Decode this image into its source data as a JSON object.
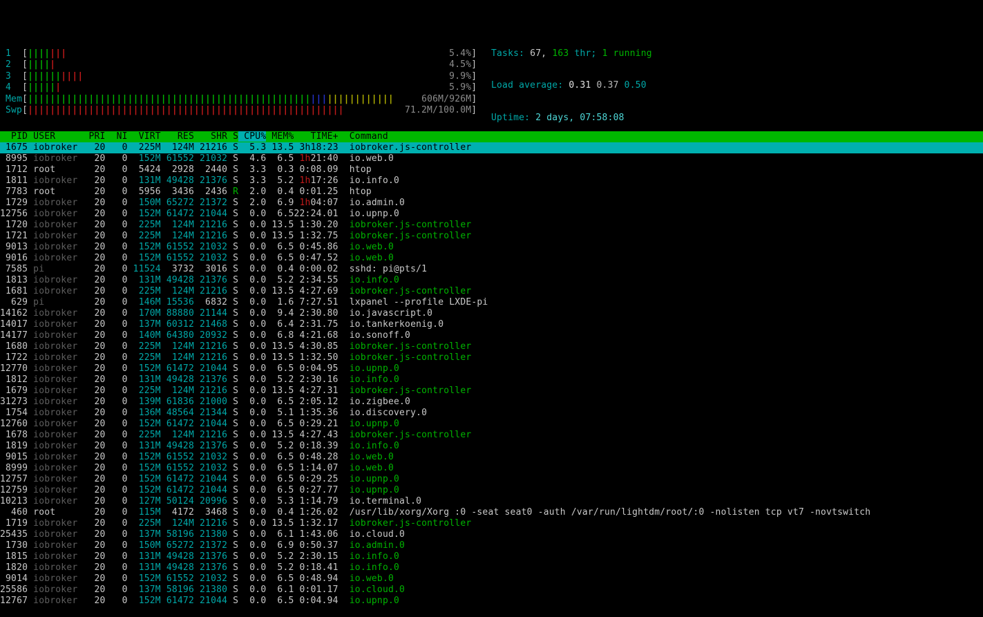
{
  "colors": {
    "background": "#000000",
    "text": "#c9c9c9",
    "dim_text": "#5e5e5e",
    "cyan": "#00a8a8",
    "bright_cyan": "#4ed8d8",
    "green": "#00b400",
    "red": "#c21a1a",
    "blue": "#2632cc",
    "yellow": "#b0b000",
    "meter_value": "#8c8c8c",
    "header_bg": "#00b800",
    "selected_bg": "#00b0b0"
  },
  "meters": {
    "bar_char": "|",
    "bracket_open": "[",
    "bracket_close": "]",
    "inner_width": 80,
    "cpus": [
      {
        "label": "1",
        "segments": [
          {
            "color": "green",
            "bars": 4
          },
          {
            "color": "red",
            "bars": 3
          }
        ],
        "value": "5.4%"
      },
      {
        "label": "2",
        "segments": [
          {
            "color": "green",
            "bars": 4
          },
          {
            "color": "red",
            "bars": 1
          }
        ],
        "value": "4.5%"
      },
      {
        "label": "3",
        "segments": [
          {
            "color": "green",
            "bars": 6
          },
          {
            "color": "red",
            "bars": 4
          }
        ],
        "value": "9.9%"
      },
      {
        "label": "4",
        "segments": [
          {
            "color": "green",
            "bars": 5
          },
          {
            "color": "red",
            "bars": 1
          }
        ],
        "value": "5.9%"
      }
    ],
    "mem": {
      "label": "Mem",
      "segments": [
        {
          "color": "green",
          "bars": 51
        },
        {
          "color": "blue",
          "bars": 3
        },
        {
          "color": "yellow",
          "bars": 12
        }
      ],
      "value": "606M/926M"
    },
    "swp": {
      "label": "Swp",
      "segments": [
        {
          "color": "red",
          "bars": 57
        }
      ],
      "value": "71.2M/100.0M"
    }
  },
  "sysinfo": {
    "tasks": {
      "label": "Tasks:",
      "count": "67,",
      "threads": "163",
      "thr": "thr;",
      "running": "1 running"
    },
    "load": {
      "label": "Load average:",
      "one": "0.31",
      "five": "0.37",
      "fifteen": "0.50"
    },
    "uptime": {
      "label": "Uptime:",
      "value": "2 days, 07:58:08"
    }
  },
  "table": {
    "sort_key": "cpu",
    "columns": [
      {
        "key": "pid",
        "label": "PID"
      },
      {
        "key": "user",
        "label": "USER"
      },
      {
        "key": "pri",
        "label": "PRI"
      },
      {
        "key": "ni",
        "label": "NI"
      },
      {
        "key": "virt",
        "label": "VIRT"
      },
      {
        "key": "res",
        "label": "RES"
      },
      {
        "key": "shr",
        "label": "SHR"
      },
      {
        "key": "s",
        "label": "S"
      },
      {
        "key": "cpu",
        "label": "CPU%"
      },
      {
        "key": "mem",
        "label": "MEM%"
      },
      {
        "key": "time",
        "label": "TIME+"
      },
      {
        "key": "command",
        "label": "Command"
      }
    ],
    "rows": [
      {
        "pid": "1675",
        "user": "iobroker",
        "pri": "20",
        "ni": "0",
        "virt": "225M",
        "res": "124M",
        "shr": "21216",
        "s": "S",
        "cpu": "5.3",
        "mem": "13.5",
        "time": "3h18:23",
        "command": "iobroker.js-controller",
        "selected": true
      },
      {
        "pid": "8995",
        "user": "iobroker",
        "pri": "20",
        "ni": "0",
        "virt": "152M",
        "res": "61552",
        "shr": "21032",
        "s": "S",
        "cpu": "4.6",
        "mem": "6.5",
        "time": "1h21:40",
        "command": "io.web.0"
      },
      {
        "pid": "1712",
        "user": "root",
        "pri": "20",
        "ni": "0",
        "virt": "5424",
        "res": "2928",
        "shr": "2440",
        "s": "S",
        "cpu": "3.3",
        "mem": "0.3",
        "time": "0:08.09",
        "command": "htop"
      },
      {
        "pid": "1811",
        "user": "iobroker",
        "pri": "20",
        "ni": "0",
        "virt": "131M",
        "res": "49428",
        "shr": "21376",
        "s": "S",
        "cpu": "3.3",
        "mem": "5.2",
        "time": "1h17:26",
        "command": "io.info.0"
      },
      {
        "pid": "7783",
        "user": "root",
        "pri": "20",
        "ni": "0",
        "virt": "5956",
        "res": "3436",
        "shr": "2436",
        "s": "R",
        "cpu": "2.0",
        "mem": "0.4",
        "time": "0:01.25",
        "command": "htop"
      },
      {
        "pid": "1729",
        "user": "iobroker",
        "pri": "20",
        "ni": "0",
        "virt": "150M",
        "res": "65272",
        "shr": "21372",
        "s": "S",
        "cpu": "2.0",
        "mem": "6.9",
        "time": "1h04:07",
        "command": "io.admin.0"
      },
      {
        "pid": "12756",
        "user": "iobroker",
        "pri": "20",
        "ni": "0",
        "virt": "152M",
        "res": "61472",
        "shr": "21044",
        "s": "S",
        "cpu": "0.0",
        "mem": "6.5",
        "time": "22:24.01",
        "command": "io.upnp.0"
      },
      {
        "pid": "1720",
        "user": "iobroker",
        "pri": "20",
        "ni": "0",
        "virt": "225M",
        "res": "124M",
        "shr": "21216",
        "s": "S",
        "cpu": "0.0",
        "mem": "13.5",
        "time": "1:30.20",
        "command": "iobroker.js-controller",
        "thread": true
      },
      {
        "pid": "1721",
        "user": "iobroker",
        "pri": "20",
        "ni": "0",
        "virt": "225M",
        "res": "124M",
        "shr": "21216",
        "s": "S",
        "cpu": "0.0",
        "mem": "13.5",
        "time": "1:32.75",
        "command": "iobroker.js-controller",
        "thread": true
      },
      {
        "pid": "9013",
        "user": "iobroker",
        "pri": "20",
        "ni": "0",
        "virt": "152M",
        "res": "61552",
        "shr": "21032",
        "s": "S",
        "cpu": "0.0",
        "mem": "6.5",
        "time": "0:45.86",
        "command": "io.web.0",
        "thread": true
      },
      {
        "pid": "9016",
        "user": "iobroker",
        "pri": "20",
        "ni": "0",
        "virt": "152M",
        "res": "61552",
        "shr": "21032",
        "s": "S",
        "cpu": "0.0",
        "mem": "6.5",
        "time": "0:47.52",
        "command": "io.web.0",
        "thread": true
      },
      {
        "pid": "7585",
        "user": "pi",
        "pri": "20",
        "ni": "0",
        "virt": "11524",
        "res": "3732",
        "shr": "3016",
        "s": "S",
        "cpu": "0.0",
        "mem": "0.4",
        "time": "0:00.02",
        "command": "sshd: pi@pts/1"
      },
      {
        "pid": "1813",
        "user": "iobroker",
        "pri": "20",
        "ni": "0",
        "virt": "131M",
        "res": "49428",
        "shr": "21376",
        "s": "S",
        "cpu": "0.0",
        "mem": "5.2",
        "time": "2:34.55",
        "command": "io.info.0",
        "thread": true
      },
      {
        "pid": "1681",
        "user": "iobroker",
        "pri": "20",
        "ni": "0",
        "virt": "225M",
        "res": "124M",
        "shr": "21216",
        "s": "S",
        "cpu": "0.0",
        "mem": "13.5",
        "time": "4:27.69",
        "command": "iobroker.js-controller",
        "thread": true
      },
      {
        "pid": "629",
        "user": "pi",
        "pri": "20",
        "ni": "0",
        "virt": "146M",
        "res": "15536",
        "shr": "6832",
        "s": "S",
        "cpu": "0.0",
        "mem": "1.6",
        "time": "7:27.51",
        "command": "lxpanel --profile LXDE-pi"
      },
      {
        "pid": "14162",
        "user": "iobroker",
        "pri": "20",
        "ni": "0",
        "virt": "170M",
        "res": "88880",
        "shr": "21144",
        "s": "S",
        "cpu": "0.0",
        "mem": "9.4",
        "time": "2:30.80",
        "command": "io.javascript.0"
      },
      {
        "pid": "14017",
        "user": "iobroker",
        "pri": "20",
        "ni": "0",
        "virt": "137M",
        "res": "60312",
        "shr": "21468",
        "s": "S",
        "cpu": "0.0",
        "mem": "6.4",
        "time": "2:31.75",
        "command": "io.tankerkoenig.0"
      },
      {
        "pid": "14177",
        "user": "iobroker",
        "pri": "20",
        "ni": "0",
        "virt": "140M",
        "res": "64380",
        "shr": "20932",
        "s": "S",
        "cpu": "0.0",
        "mem": "6.8",
        "time": "4:21.68",
        "command": "io.sonoff.0"
      },
      {
        "pid": "1680",
        "user": "iobroker",
        "pri": "20",
        "ni": "0",
        "virt": "225M",
        "res": "124M",
        "shr": "21216",
        "s": "S",
        "cpu": "0.0",
        "mem": "13.5",
        "time": "4:30.85",
        "command": "iobroker.js-controller",
        "thread": true
      },
      {
        "pid": "1722",
        "user": "iobroker",
        "pri": "20",
        "ni": "0",
        "virt": "225M",
        "res": "124M",
        "shr": "21216",
        "s": "S",
        "cpu": "0.0",
        "mem": "13.5",
        "time": "1:32.50",
        "command": "iobroker.js-controller",
        "thread": true
      },
      {
        "pid": "12770",
        "user": "iobroker",
        "pri": "20",
        "ni": "0",
        "virt": "152M",
        "res": "61472",
        "shr": "21044",
        "s": "S",
        "cpu": "0.0",
        "mem": "6.5",
        "time": "0:04.95",
        "command": "io.upnp.0",
        "thread": true
      },
      {
        "pid": "1812",
        "user": "iobroker",
        "pri": "20",
        "ni": "0",
        "virt": "131M",
        "res": "49428",
        "shr": "21376",
        "s": "S",
        "cpu": "0.0",
        "mem": "5.2",
        "time": "2:30.16",
        "command": "io.info.0",
        "thread": true
      },
      {
        "pid": "1679",
        "user": "iobroker",
        "pri": "20",
        "ni": "0",
        "virt": "225M",
        "res": "124M",
        "shr": "21216",
        "s": "S",
        "cpu": "0.0",
        "mem": "13.5",
        "time": "4:27.31",
        "command": "iobroker.js-controller",
        "thread": true
      },
      {
        "pid": "31273",
        "user": "iobroker",
        "pri": "20",
        "ni": "0",
        "virt": "139M",
        "res": "61836",
        "shr": "21000",
        "s": "S",
        "cpu": "0.0",
        "mem": "6.5",
        "time": "2:05.12",
        "command": "io.zigbee.0"
      },
      {
        "pid": "1754",
        "user": "iobroker",
        "pri": "20",
        "ni": "0",
        "virt": "136M",
        "res": "48564",
        "shr": "21344",
        "s": "S",
        "cpu": "0.0",
        "mem": "5.1",
        "time": "1:35.36",
        "command": "io.discovery.0"
      },
      {
        "pid": "12760",
        "user": "iobroker",
        "pri": "20",
        "ni": "0",
        "virt": "152M",
        "res": "61472",
        "shr": "21044",
        "s": "S",
        "cpu": "0.0",
        "mem": "6.5",
        "time": "0:29.21",
        "command": "io.upnp.0",
        "thread": true
      },
      {
        "pid": "1678",
        "user": "iobroker",
        "pri": "20",
        "ni": "0",
        "virt": "225M",
        "res": "124M",
        "shr": "21216",
        "s": "S",
        "cpu": "0.0",
        "mem": "13.5",
        "time": "4:27.43",
        "command": "iobroker.js-controller",
        "thread": true
      },
      {
        "pid": "1819",
        "user": "iobroker",
        "pri": "20",
        "ni": "0",
        "virt": "131M",
        "res": "49428",
        "shr": "21376",
        "s": "S",
        "cpu": "0.0",
        "mem": "5.2",
        "time": "0:18.39",
        "command": "io.info.0",
        "thread": true
      },
      {
        "pid": "9015",
        "user": "iobroker",
        "pri": "20",
        "ni": "0",
        "virt": "152M",
        "res": "61552",
        "shr": "21032",
        "s": "S",
        "cpu": "0.0",
        "mem": "6.5",
        "time": "0:48.28",
        "command": "io.web.0",
        "thread": true
      },
      {
        "pid": "8999",
        "user": "iobroker",
        "pri": "20",
        "ni": "0",
        "virt": "152M",
        "res": "61552",
        "shr": "21032",
        "s": "S",
        "cpu": "0.0",
        "mem": "6.5",
        "time": "1:14.07",
        "command": "io.web.0",
        "thread": true
      },
      {
        "pid": "12757",
        "user": "iobroker",
        "pri": "20",
        "ni": "0",
        "virt": "152M",
        "res": "61472",
        "shr": "21044",
        "s": "S",
        "cpu": "0.0",
        "mem": "6.5",
        "time": "0:29.25",
        "command": "io.upnp.0",
        "thread": true
      },
      {
        "pid": "12759",
        "user": "iobroker",
        "pri": "20",
        "ni": "0",
        "virt": "152M",
        "res": "61472",
        "shr": "21044",
        "s": "S",
        "cpu": "0.0",
        "mem": "6.5",
        "time": "0:27.77",
        "command": "io.upnp.0",
        "thread": true
      },
      {
        "pid": "10213",
        "user": "iobroker",
        "pri": "20",
        "ni": "0",
        "virt": "127M",
        "res": "50124",
        "shr": "20996",
        "s": "S",
        "cpu": "0.0",
        "mem": "5.3",
        "time": "1:14.79",
        "command": "io.terminal.0"
      },
      {
        "pid": "460",
        "user": "root",
        "pri": "20",
        "ni": "0",
        "virt": "115M",
        "res": "4172",
        "shr": "3468",
        "s": "S",
        "cpu": "0.0",
        "mem": "0.4",
        "time": "1:26.02",
        "command": "/usr/lib/xorg/Xorg :0 -seat seat0 -auth /var/run/lightdm/root/:0 -nolisten tcp vt7 -novtswitch"
      },
      {
        "pid": "1719",
        "user": "iobroker",
        "pri": "20",
        "ni": "0",
        "virt": "225M",
        "res": "124M",
        "shr": "21216",
        "s": "S",
        "cpu": "0.0",
        "mem": "13.5",
        "time": "1:32.17",
        "command": "iobroker.js-controller",
        "thread": true
      },
      {
        "pid": "25435",
        "user": "iobroker",
        "pri": "20",
        "ni": "0",
        "virt": "137M",
        "res": "58196",
        "shr": "21380",
        "s": "S",
        "cpu": "0.0",
        "mem": "6.1",
        "time": "1:43.06",
        "command": "io.cloud.0"
      },
      {
        "pid": "1730",
        "user": "iobroker",
        "pri": "20",
        "ni": "0",
        "virt": "150M",
        "res": "65272",
        "shr": "21372",
        "s": "S",
        "cpu": "0.0",
        "mem": "6.9",
        "time": "0:50.37",
        "command": "io.admin.0",
        "thread": true
      },
      {
        "pid": "1815",
        "user": "iobroker",
        "pri": "20",
        "ni": "0",
        "virt": "131M",
        "res": "49428",
        "shr": "21376",
        "s": "S",
        "cpu": "0.0",
        "mem": "5.2",
        "time": "2:30.15",
        "command": "io.info.0",
        "thread": true
      },
      {
        "pid": "1820",
        "user": "iobroker",
        "pri": "20",
        "ni": "0",
        "virt": "131M",
        "res": "49428",
        "shr": "21376",
        "s": "S",
        "cpu": "0.0",
        "mem": "5.2",
        "time": "0:18.41",
        "command": "io.info.0",
        "thread": true
      },
      {
        "pid": "9014",
        "user": "iobroker",
        "pri": "20",
        "ni": "0",
        "virt": "152M",
        "res": "61552",
        "shr": "21032",
        "s": "S",
        "cpu": "0.0",
        "mem": "6.5",
        "time": "0:48.94",
        "command": "io.web.0",
        "thread": true
      },
      {
        "pid": "25586",
        "user": "iobroker",
        "pri": "20",
        "ni": "0",
        "virt": "137M",
        "res": "58196",
        "shr": "21380",
        "s": "S",
        "cpu": "0.0",
        "mem": "6.1",
        "time": "0:01.17",
        "command": "io.cloud.0",
        "thread": true
      },
      {
        "pid": "12767",
        "user": "iobroker",
        "pri": "20",
        "ni": "0",
        "virt": "152M",
        "res": "61472",
        "shr": "21044",
        "s": "S",
        "cpu": "0.0",
        "mem": "6.5",
        "time": "0:04.94",
        "command": "io.upnp.0",
        "thread": true
      }
    ]
  }
}
